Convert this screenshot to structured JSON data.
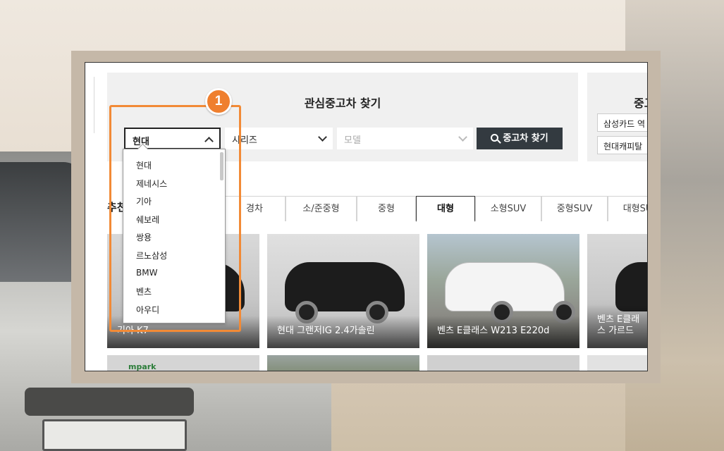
{
  "search": {
    "title": "관심중고차 찾기",
    "brand_value": "현대",
    "series_placeholder": "시리즈",
    "model_placeholder": "모델",
    "search_button": "중고차 찾기"
  },
  "side_panel": {
    "title_partial": "중고",
    "buttons": [
      "삼성카드 역",
      "현대캐피탈"
    ]
  },
  "brand_dropdown": {
    "options": [
      "현대",
      "제네시스",
      "기아",
      "쉐보레",
      "쌍용",
      "르노삼성",
      "BMW",
      "벤츠",
      "아우디"
    ]
  },
  "recommend": {
    "label": "추천",
    "tabs": [
      {
        "label": "경차",
        "active": false
      },
      {
        "label": "소/준중형",
        "active": false
      },
      {
        "label": "중형",
        "active": false
      },
      {
        "label": "대형",
        "active": true
      },
      {
        "label": "소형SUV",
        "active": false
      },
      {
        "label": "중형SUV",
        "active": false
      },
      {
        "label": "대형SUV",
        "active": false
      }
    ]
  },
  "cars": [
    {
      "name": "기아 K7"
    },
    {
      "name": "현대 그랜저IG 2.4가솔린"
    },
    {
      "name": "벤츠 E클래스 W213 E220d"
    },
    {
      "name": "벤츠 E클래스 가르드"
    }
  ],
  "bottom_cards": {
    "first_logo": "mpark"
  },
  "annotation": {
    "step_number": "1",
    "highlight_color": "#f28a36"
  },
  "colors": {
    "accent_orange": "#ef7f2e",
    "search_button_bg": "#333a40",
    "active_tab_border": "#333333"
  }
}
